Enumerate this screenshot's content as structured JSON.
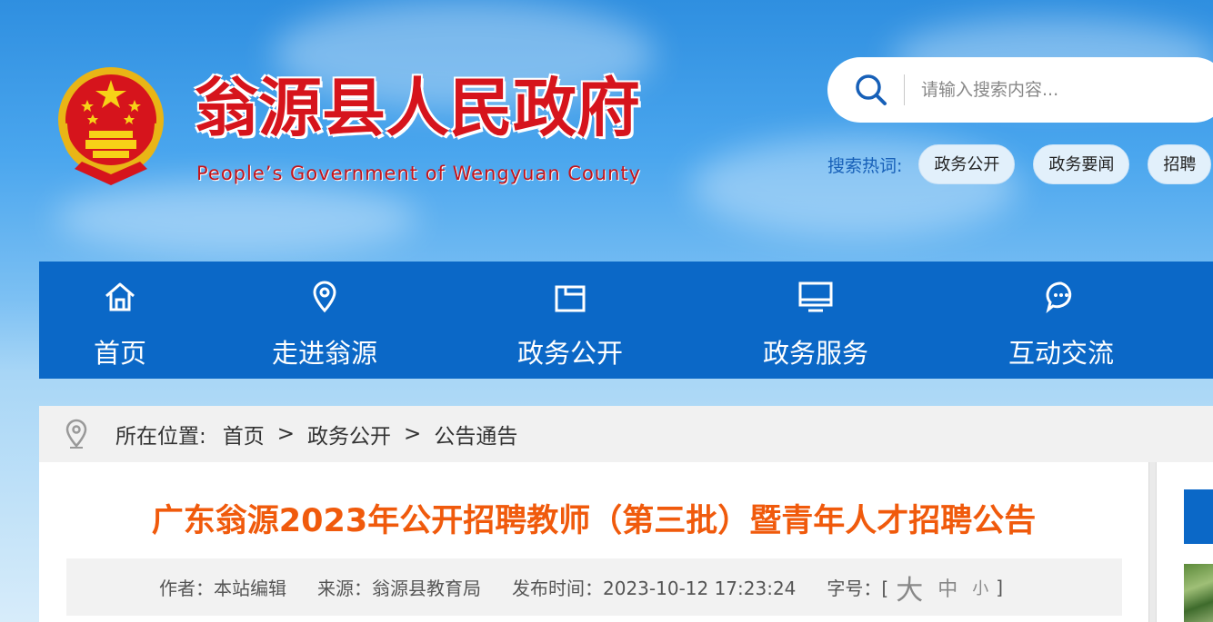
{
  "header": {
    "title": "翁源县人民政府",
    "subtitle": "People’s Government of Wengyuan County",
    "emblem_icon": "national-emblem-icon"
  },
  "search": {
    "placeholder": "请输入搜索内容...",
    "hot_label": "搜索热词:",
    "hot_words": [
      "政务公开",
      "政务要闻",
      "招聘"
    ]
  },
  "nav": {
    "items": [
      {
        "label": "首页",
        "icon": "home-icon"
      },
      {
        "label": "走进翁源",
        "icon": "location-icon"
      },
      {
        "label": "政务公开",
        "icon": "folder-icon"
      },
      {
        "label": "政务服务",
        "icon": "monitor-icon"
      },
      {
        "label": "互动交流",
        "icon": "chat-icon"
      }
    ]
  },
  "breadcrumb": {
    "prefix": "所在位置:",
    "items": [
      "首页",
      "政务公开",
      "公告通告"
    ],
    "separator": ">"
  },
  "article": {
    "title": "广东翁源2023年公开招聘教师（第三批）暨青年人才招聘公告",
    "author": "作者：本站编辑",
    "source": "来源：翁源县教育局",
    "published": "发布时间：2023-10-12 17:23:24",
    "font_size_label": "字号：[",
    "font_size_close": "]",
    "font_big": "大",
    "font_mid": "中",
    "font_small": "小"
  },
  "colors": {
    "nav_bg": "#0b68c7",
    "title_red": "#d6141c",
    "article_title": "#f05a0c",
    "hot_label": "#1760b8"
  }
}
